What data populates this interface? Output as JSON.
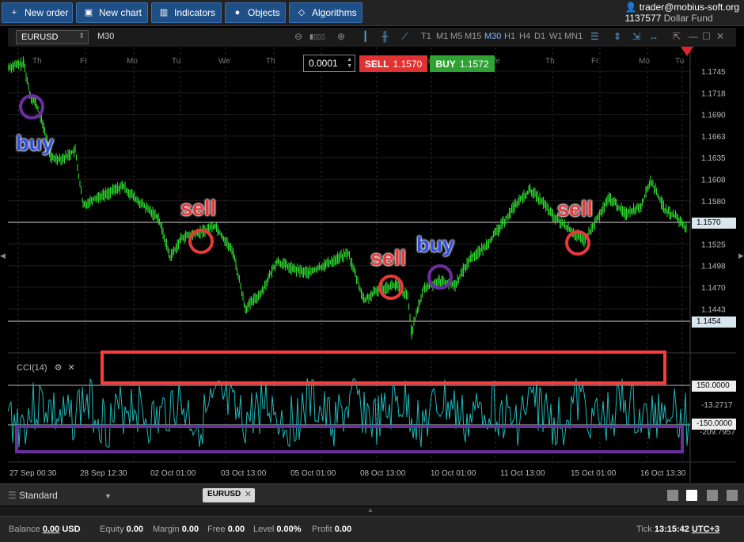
{
  "toolbar": {
    "new_order": "New order",
    "new_chart": "New chart",
    "indicators": "Indicators",
    "objects": "Objects",
    "algorithms": "Algorithms"
  },
  "account": {
    "user": "trader@mobius-soft.org",
    "number": "1137577",
    "fund": "Dollar Fund"
  },
  "chart_toolbar": {
    "symbol": "EURUSD",
    "timeframe": "M30",
    "timeframes": [
      "T1",
      "M1",
      "M5",
      "M15",
      "M30",
      "H1",
      "H4",
      "D1",
      "W1",
      "MN1"
    ],
    "active_timeframe": "M30"
  },
  "trade": {
    "quantity": "0.0001",
    "sell_label": "SELL",
    "sell_price": "1.1570",
    "buy_label": "BUY",
    "buy_price": "1.1572"
  },
  "price_axis": [
    "1.1745",
    "1.1718",
    "1.1690",
    "1.1663",
    "1.1635",
    "1.1608",
    "1.1580",
    "1.1553",
    "1.1525",
    "1.1498",
    "1.1470",
    "1.1443"
  ],
  "price_tags": {
    "current": "1.1570",
    "lower_level": "1.1454"
  },
  "top_day_labels": [
    "Th",
    "Fr",
    "Mo",
    "Tu",
    "We",
    "Th",
    "Fr",
    "Mo",
    "Tu",
    "We",
    "Th",
    "Fr",
    "Mo",
    "Tu",
    "We"
  ],
  "time_axis": [
    "27 Sep 00:30",
    "28 Sep 12:30",
    "02 Oct 01:00",
    "03 Oct 13:00",
    "05 Oct 01:00",
    "08 Oct 13:00",
    "10 Oct 01:00",
    "11 Oct 13:00",
    "15 Oct 01:00",
    "16 Oct 13:30"
  ],
  "indicator": {
    "name": "CCI(14)",
    "levels": [
      "150.0000",
      "-13.2717",
      "-150.0000",
      "-209.7957"
    ]
  },
  "annotations": {
    "buy1": "buy",
    "sell1": "sell",
    "sell2": "sell",
    "buy2": "buy",
    "sell3": "sell"
  },
  "tabs": {
    "layout": "Standard",
    "symbol_tab": "EURUSD"
  },
  "status": {
    "balance_label": "Balance",
    "balance": "0.00",
    "currency": "USD",
    "equity_label": "Equity",
    "equity": "0.00",
    "margin_label": "Margin",
    "margin": "0.00",
    "free_label": "Free",
    "free": "0.00",
    "level_label": "Level",
    "level": "0.00%",
    "profit_label": "Profit",
    "profit": "0.00",
    "tick_label": "Tick",
    "time": "13:15:42",
    "timezone": "UTC+3"
  },
  "colors": {
    "candles": "#2bd42b",
    "cci_line": "#1fb8b8",
    "sell_red": "#e13232",
    "buy_green": "#2fa332",
    "highlight_red": "#ff3a3a",
    "highlight_purple": "#6a2ea0",
    "toolbar_blue": "#1f4f87"
  }
}
